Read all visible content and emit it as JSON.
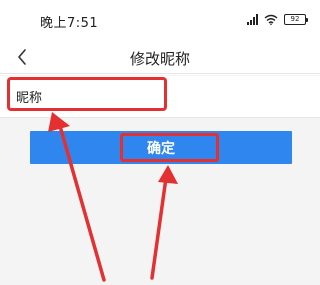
{
  "status_bar": {
    "time": "晚上7:51",
    "battery": "92",
    "icons": [
      "signal-icon",
      "wifi-icon",
      "battery-icon"
    ]
  },
  "nav": {
    "back_icon": "chevron-left-icon",
    "title": "修改昵称"
  },
  "form": {
    "nickname_placeholder": "昵称",
    "nickname_value": ""
  },
  "actions": {
    "confirm_label": "确定"
  },
  "colors": {
    "accent": "#2f86ee",
    "annotation": "#e43030",
    "background": "#f4f4f4"
  }
}
